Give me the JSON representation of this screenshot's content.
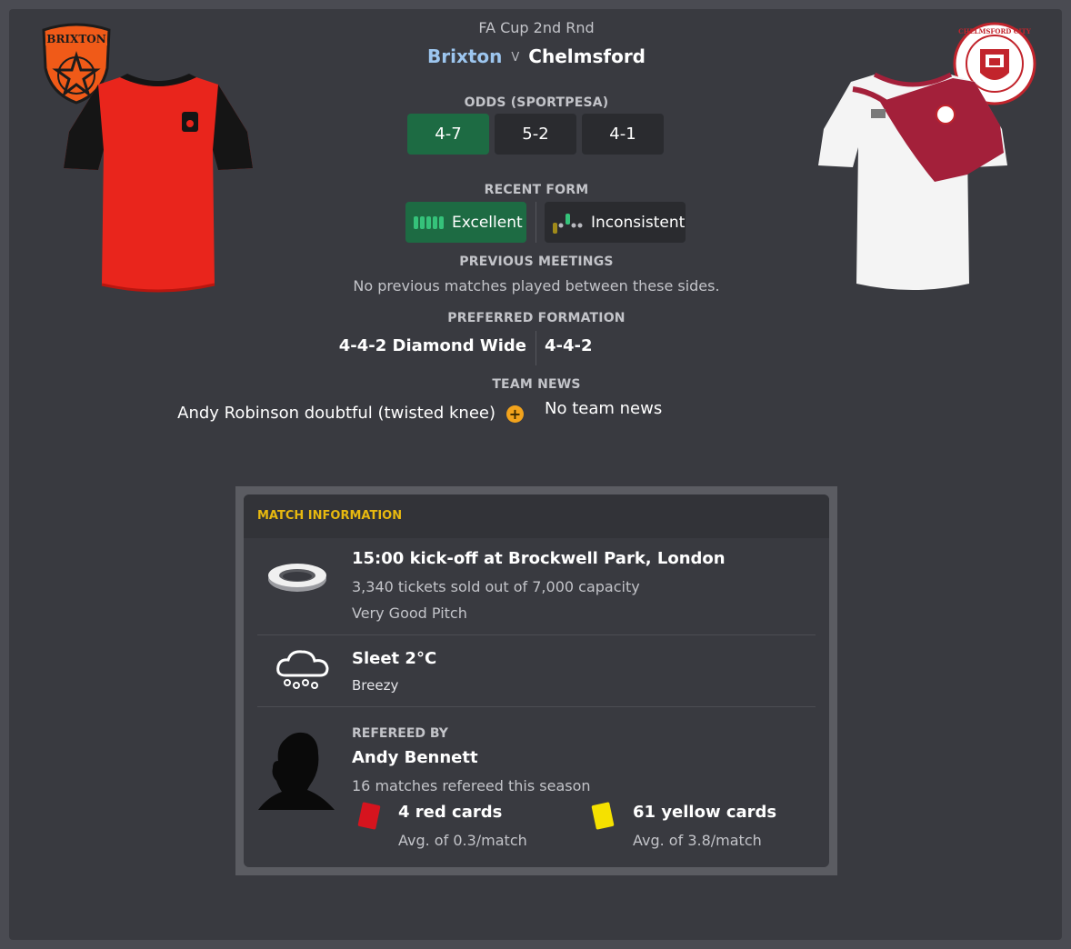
{
  "header": {
    "competition": "FA Cup 2nd Rnd",
    "home_team": "Brixton",
    "vs": "V",
    "away_team": "Chelmsford",
    "home_badge_text": "BRIXTON",
    "away_badge_text": "CHELMSFORD CITY"
  },
  "odds": {
    "label": "ODDS (SPORTPESA)",
    "values": [
      "4-7",
      "5-2",
      "4-1"
    ]
  },
  "recent_form": {
    "label": "RECENT FORM",
    "home": "Excellent",
    "away": "Inconsistent"
  },
  "previous_meetings": {
    "label": "PREVIOUS MEETINGS",
    "text": "No previous matches played between these sides."
  },
  "formation": {
    "label": "PREFERRED FORMATION",
    "home": "4-4-2 Diamond Wide",
    "away": "4-4-2"
  },
  "team_news": {
    "label": "TEAM NEWS",
    "home": "Andy Robinson doubtful (twisted knee)",
    "away": "No team news"
  },
  "match_info": {
    "title": "MATCH INFORMATION",
    "venue_line": "15:00 kick-off at Brockwell Park, London",
    "tickets": "3,340 tickets sold out of 7,000 capacity",
    "pitch": "Very Good Pitch",
    "weather": "Sleet 2°C",
    "wind": "Breezy",
    "referee_label": "REFEREED BY",
    "referee_name": "Andy Bennett",
    "referee_matches": "16 matches refereed this season",
    "red_cards": "4 red cards",
    "red_avg": "Avg. of 0.3/match",
    "yellow_cards": "61 yellow cards",
    "yellow_avg": "Avg. of 3.8/match"
  },
  "colors": {
    "accent_green": "#1d6b43",
    "title_gold": "#e7b80f",
    "home_link": "#9dc6ef",
    "red_card": "#d6141e",
    "yellow_card": "#f5e100"
  }
}
